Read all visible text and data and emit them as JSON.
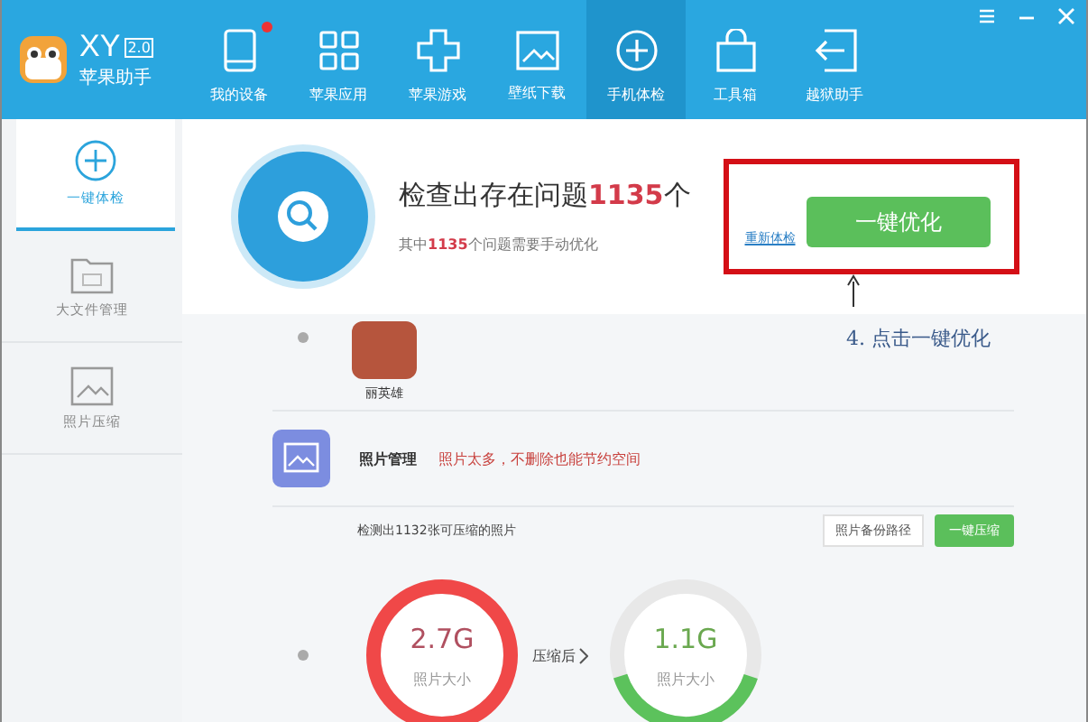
{
  "app": {
    "name": "XY",
    "version": "2.0",
    "subtitle": "苹果助手"
  },
  "nav": [
    {
      "label": "我的设备",
      "selected": false,
      "badge": true
    },
    {
      "label": "苹果应用",
      "selected": false,
      "badge": false
    },
    {
      "label": "苹果游戏",
      "selected": false,
      "badge": false
    },
    {
      "label": "壁纸下载",
      "selected": false,
      "badge": false
    },
    {
      "label": "手机体检",
      "selected": true,
      "badge": false
    },
    {
      "label": "工具箱",
      "selected": false,
      "badge": false
    },
    {
      "label": "越狱助手",
      "selected": false,
      "badge": false
    }
  ],
  "sidebar": [
    {
      "label": "一键体检",
      "selected": true
    },
    {
      "label": "大文件管理",
      "selected": false
    },
    {
      "label": "照片压缩",
      "selected": false
    }
  ],
  "summary": {
    "title": "检查出存在问题**1135**个",
    "detail": "其中**1135**个问题需要手动优化",
    "recheck": "重新体检",
    "optimize": "一键优化"
  },
  "annotation": "4. 点击一键优化",
  "app_item": {
    "name": "丽英雄"
  },
  "photo_section": {
    "title": "照片管理",
    "warning": "照片太多，不删除也能节约空间",
    "found": "检测出1132张可压缩的照片",
    "backup": "照片备份路径",
    "compress": "一键压缩",
    "before": {
      "size": "2.7G",
      "caption": "照片大小",
      "level": 1
    },
    "arrow": "压缩后",
    "after": {
      "size": "1.1G",
      "caption": "照片大小",
      "level": 0.4
    }
  }
}
